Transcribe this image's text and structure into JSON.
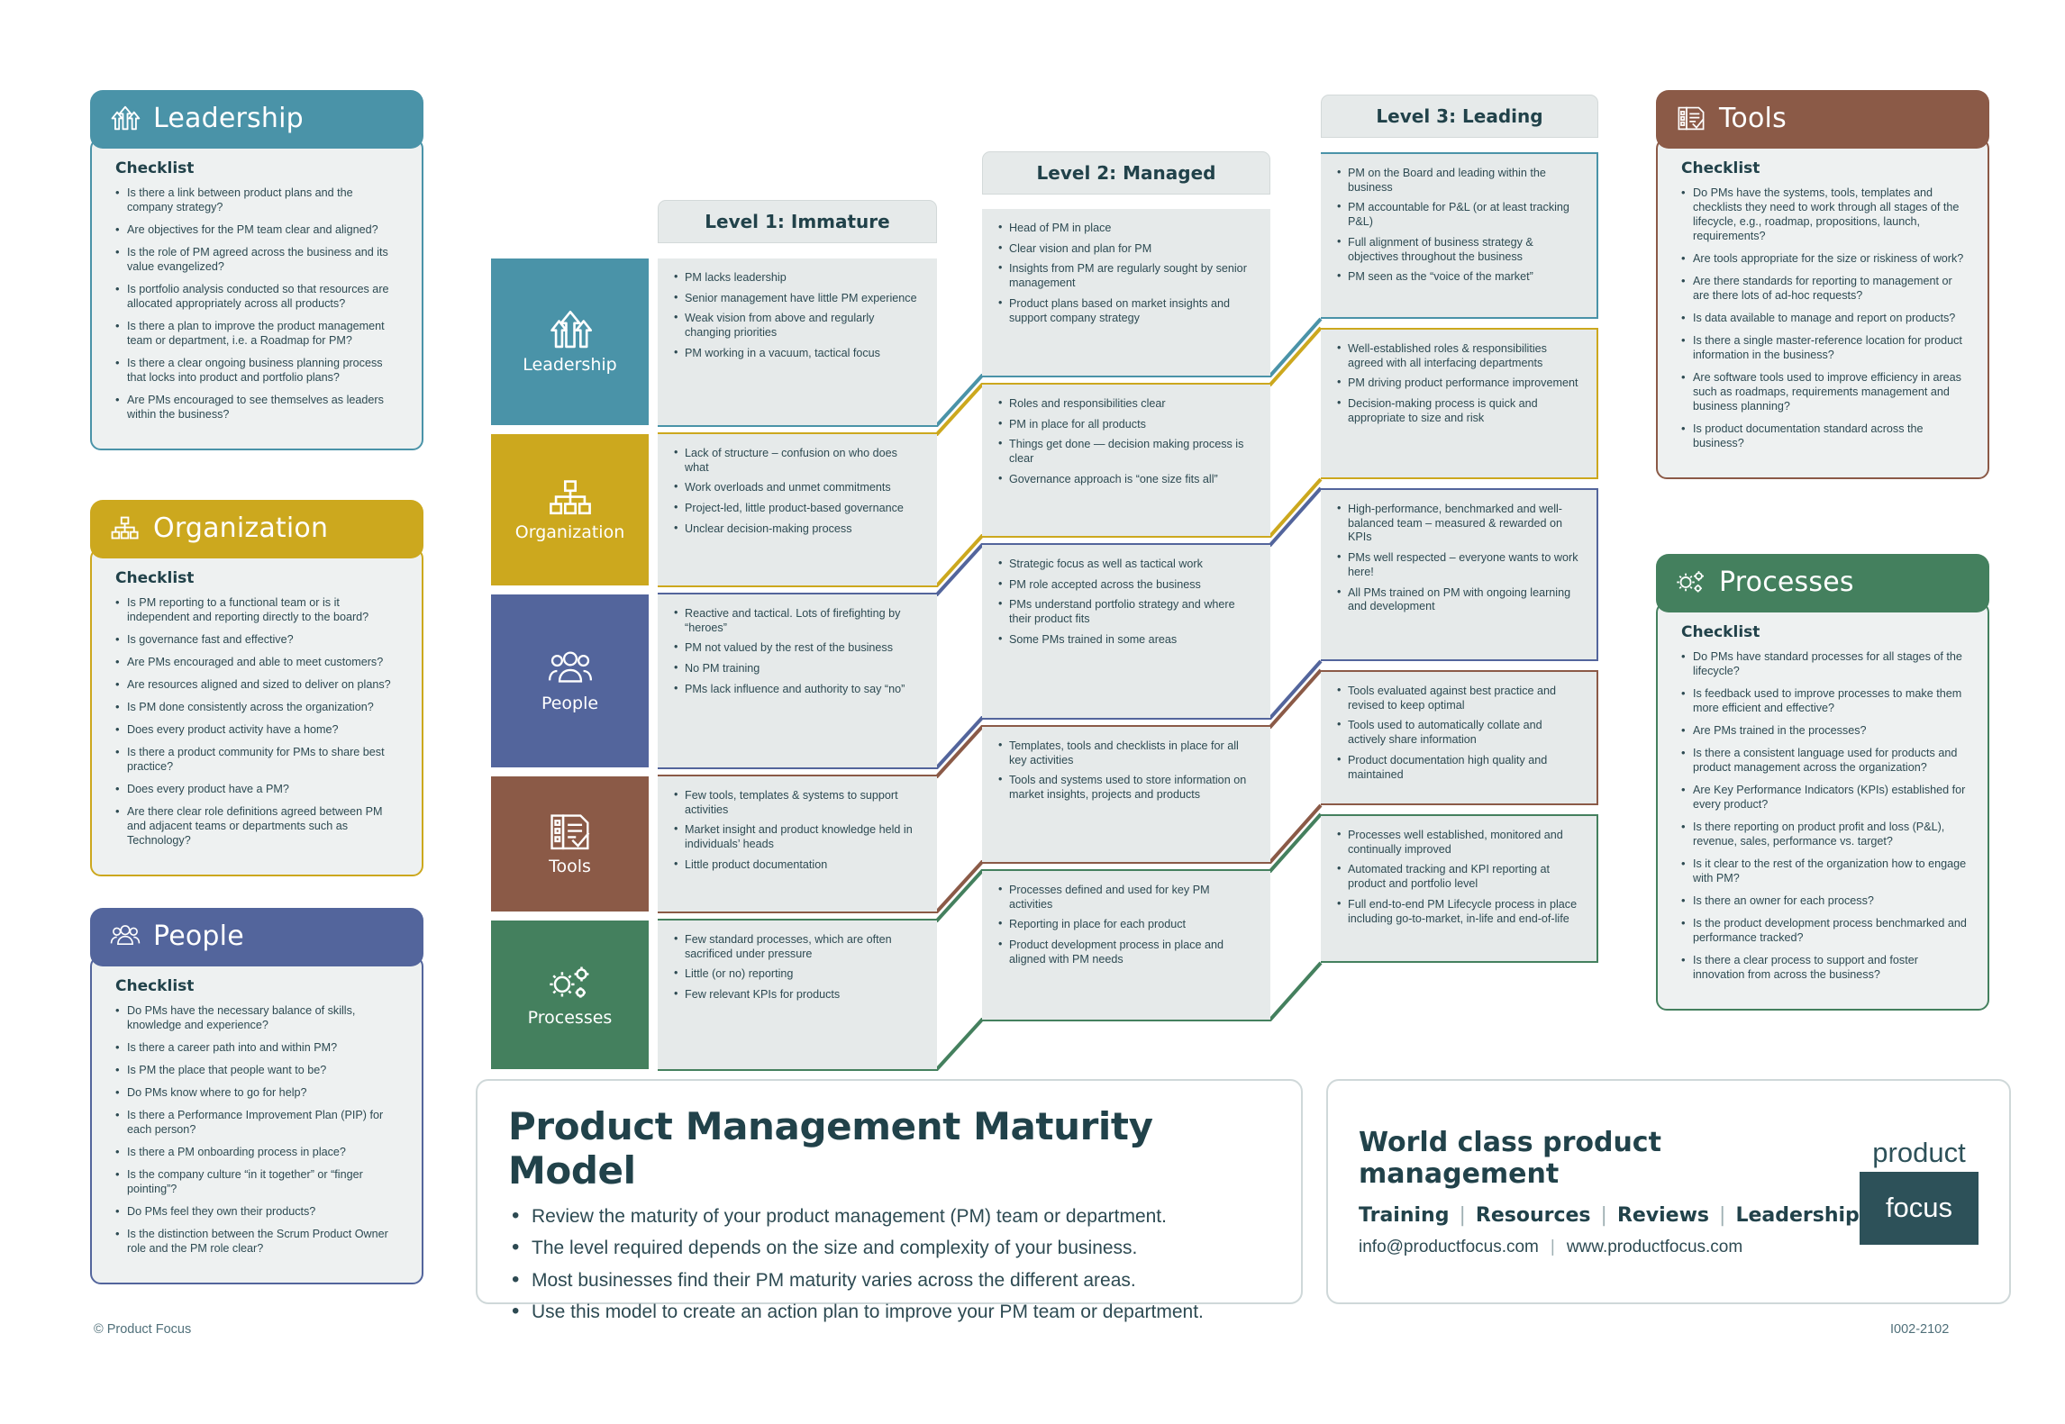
{
  "panels": {
    "leadership": {
      "title": "Leadership",
      "icon": "arrows-up-icon",
      "color": "#4a93a8",
      "checklist_label": "Checklist",
      "items": [
        "Is there a link between product plans and the company strategy?",
        "Are objectives for the PM team clear and aligned?",
        "Is the role of PM agreed across the business and its value evangelized?",
        "Is portfolio analysis conducted so that resources are allocated appropriately across all products?",
        "Is there a plan to improve the product management team or department, i.e. a Roadmap for PM?",
        "Is there a clear ongoing business planning process that locks into product and portfolio plans?",
        "Are PMs encouraged to see themselves as leaders within the business?"
      ]
    },
    "organization": {
      "title": "Organization",
      "icon": "org-chart-icon",
      "color": "#cca81e",
      "checklist_label": "Checklist",
      "items": [
        "Is PM reporting to a functional team or is it independent and reporting directly to the board?",
        "Is governance fast and effective?",
        "Are PMs encouraged and able to meet customers?",
        "Are resources aligned and sized to deliver on plans?",
        "Is PM done consistently across the organization?",
        "Does every product activity have a home?",
        "Is there a product community for PMs to share best practice?",
        "Does every product have a PM?",
        "Are there clear role definitions agreed between PM and adjacent teams or departments such as Technology?"
      ]
    },
    "people": {
      "title": "People",
      "icon": "people-group-icon",
      "color": "#53659c",
      "checklist_label": "Checklist",
      "items": [
        "Do PMs have the necessary balance of skills, knowledge and experience?",
        "Is there a career path into and within PM?",
        "Is PM the place that people want to be?",
        "Do PMs know where to go for help?",
        "Is there a Performance Improvement Plan (PIP) for each person?",
        "Is there a PM onboarding process in place?",
        "Is the company culture “in it together” or “finger pointing”?",
        "Do PMs feel they own their products?",
        "Is the distinction between the Scrum Product Owner role and the PM role clear?"
      ]
    },
    "tools": {
      "title": "Tools",
      "icon": "clipboard-check-icon",
      "color": "#8b5a47",
      "checklist_label": "Checklist",
      "items": [
        "Do PMs have the systems, tools, templates and checklists they need to work through all stages of the lifecycle, e.g., roadmap, propositions, launch, requirements?",
        "Are tools appropriate for the size or riskiness of work?",
        "Are there standards for reporting to management or are there lots of ad-hoc requests?",
        "Is data available to manage and report on products?",
        "Is there a single master-reference location for product information in the business?",
        "Are software tools used to improve efficiency in areas such as roadmaps, requirements management and business planning?",
        "Is product documentation standard across the business?"
      ]
    },
    "processes": {
      "title": "Processes",
      "icon": "gears-icon",
      "color": "#44805e",
      "checklist_label": "Checklist",
      "items": [
        "Do PMs have standard processes  for all stages of the lifecycle?",
        "Is feedback used to improve processes to make them more efficient and effective?",
        "Are PMs trained in the processes?",
        "Is there a consistent language used for products and product management across the organization?",
        "Are Key Performance Indicators (KPIs) established for every product?",
        "Is there reporting on product profit and loss (P&L), revenue, sales, performance vs. target?",
        "Is it clear to the rest of the organization how to engage with PM?",
        "Is there an owner for each process?",
        "Is the product development process benchmarked and performance tracked?",
        "Is there a clear process to support and foster innovation from across the business?"
      ]
    }
  },
  "matrix": {
    "levels": [
      {
        "key": "l1",
        "label": "Level 1: Immature"
      },
      {
        "key": "l2",
        "label": "Level 2: Managed"
      },
      {
        "key": "l3",
        "label": "Level 3: Leading"
      }
    ],
    "rows": [
      {
        "key": "leadership",
        "label": "Leadership",
        "icon": "arrows-up-icon",
        "color": "#4a93a8",
        "l1": [
          "PM lacks leadership",
          "Senior management have little PM experience",
          "Weak vision from above and regularly changing priorities",
          "PM working in a vacuum, tactical focus"
        ],
        "l2": [
          "Head of PM in place",
          "Clear vision and plan for PM",
          "Insights from PM are regularly sought by senior management",
          "Product plans based on market insights and support company strategy"
        ],
        "l3": [
          "PM on the Board and leading within the business",
          "PM accountable for P&L (or at least tracking P&L)",
          "Full alignment of business strategy & objectives throughout the business",
          "PM seen as the “voice of the market”"
        ]
      },
      {
        "key": "organization",
        "label": "Organization",
        "icon": "org-chart-icon",
        "color": "#cca81e",
        "l1": [
          "Lack of structure – confusion on who does what",
          "Work overloads and unmet commitments",
          "Project-led, little product-based governance",
          "Unclear decision-making process"
        ],
        "l2": [
          "Roles and responsibilities clear",
          "PM in place for all products",
          "Things get done — decision making process is clear",
          "Governance approach is “one size fits all”"
        ],
        "l3": [
          "Well-established roles & responsibilities agreed with all interfacing departments",
          "PM driving product performance improvement",
          "Decision-making process is quick and appropriate to size and risk"
        ]
      },
      {
        "key": "people",
        "label": "People",
        "icon": "people-group-icon",
        "color": "#53659c",
        "l1": [
          "Reactive and tactical. Lots of firefighting by “heroes”",
          "PM not valued by the rest of the business",
          "No PM training",
          "PMs lack influence and authority to say “no”"
        ],
        "l2": [
          "Strategic focus as well as tactical work",
          "PM role accepted across the business",
          "PMs understand portfolio strategy and where their product fits",
          "Some PMs trained in some areas"
        ],
        "l3": [
          "High-performance, benchmarked and well-balanced team – measured & rewarded on KPIs",
          "PMs well respected – everyone wants to work here!",
          "All PMs trained on PM with ongoing learning and development"
        ]
      },
      {
        "key": "tools",
        "label": "Tools",
        "icon": "clipboard-check-icon",
        "color": "#8b5a47",
        "l1": [
          "Few tools, templates & systems to support activities",
          "Market insight and product knowledge held in individuals’ heads",
          "Little product documentation"
        ],
        "l2": [
          "Templates, tools and checklists in place for all key activities",
          "Tools and systems used to store information on market insights, projects and products"
        ],
        "l3": [
          "Tools evaluated against best practice and revised to keep optimal",
          "Tools used to automatically collate and actively share information",
          "Product documentation high quality and maintained"
        ]
      },
      {
        "key": "processes",
        "label": "Processes",
        "icon": "gears-icon",
        "color": "#44805e",
        "l1": [
          "Few standard processes, which are often sacrificed under pressure",
          "Little (or no) reporting",
          "Few relevant KPIs for products"
        ],
        "l2": [
          "Processes defined and used for key PM activities",
          "Reporting in place for each product",
          "Product development process in place and aligned with PM needs"
        ],
        "l3": [
          "Processes well established, monitored and continually improved",
          "Automated tracking and KPI reporting at product and portfolio level",
          "Full end-to-end PM Lifecycle process in place including go-to-market, in-life and end-of-life"
        ]
      }
    ]
  },
  "title_box": {
    "title": "Product Management Maturity Model",
    "bullets": [
      "Review the maturity of your product management (PM) team or department.",
      "The level required depends on the size and complexity of your business.",
      "Most businesses find their PM maturity varies across the different areas.",
      "Use this model to create an action plan to improve your PM team or department."
    ]
  },
  "brand_box": {
    "headline": "World class product management",
    "nav": [
      "Training",
      "Resources",
      "Reviews",
      "Leadership"
    ],
    "separator": "|",
    "email": "info@productfocus.com",
    "website": "www.productfocus.com",
    "logo_top": "product",
    "logo_bottom": "focus"
  },
  "footer": {
    "left": "© Product Focus",
    "right": "I002-2102"
  }
}
